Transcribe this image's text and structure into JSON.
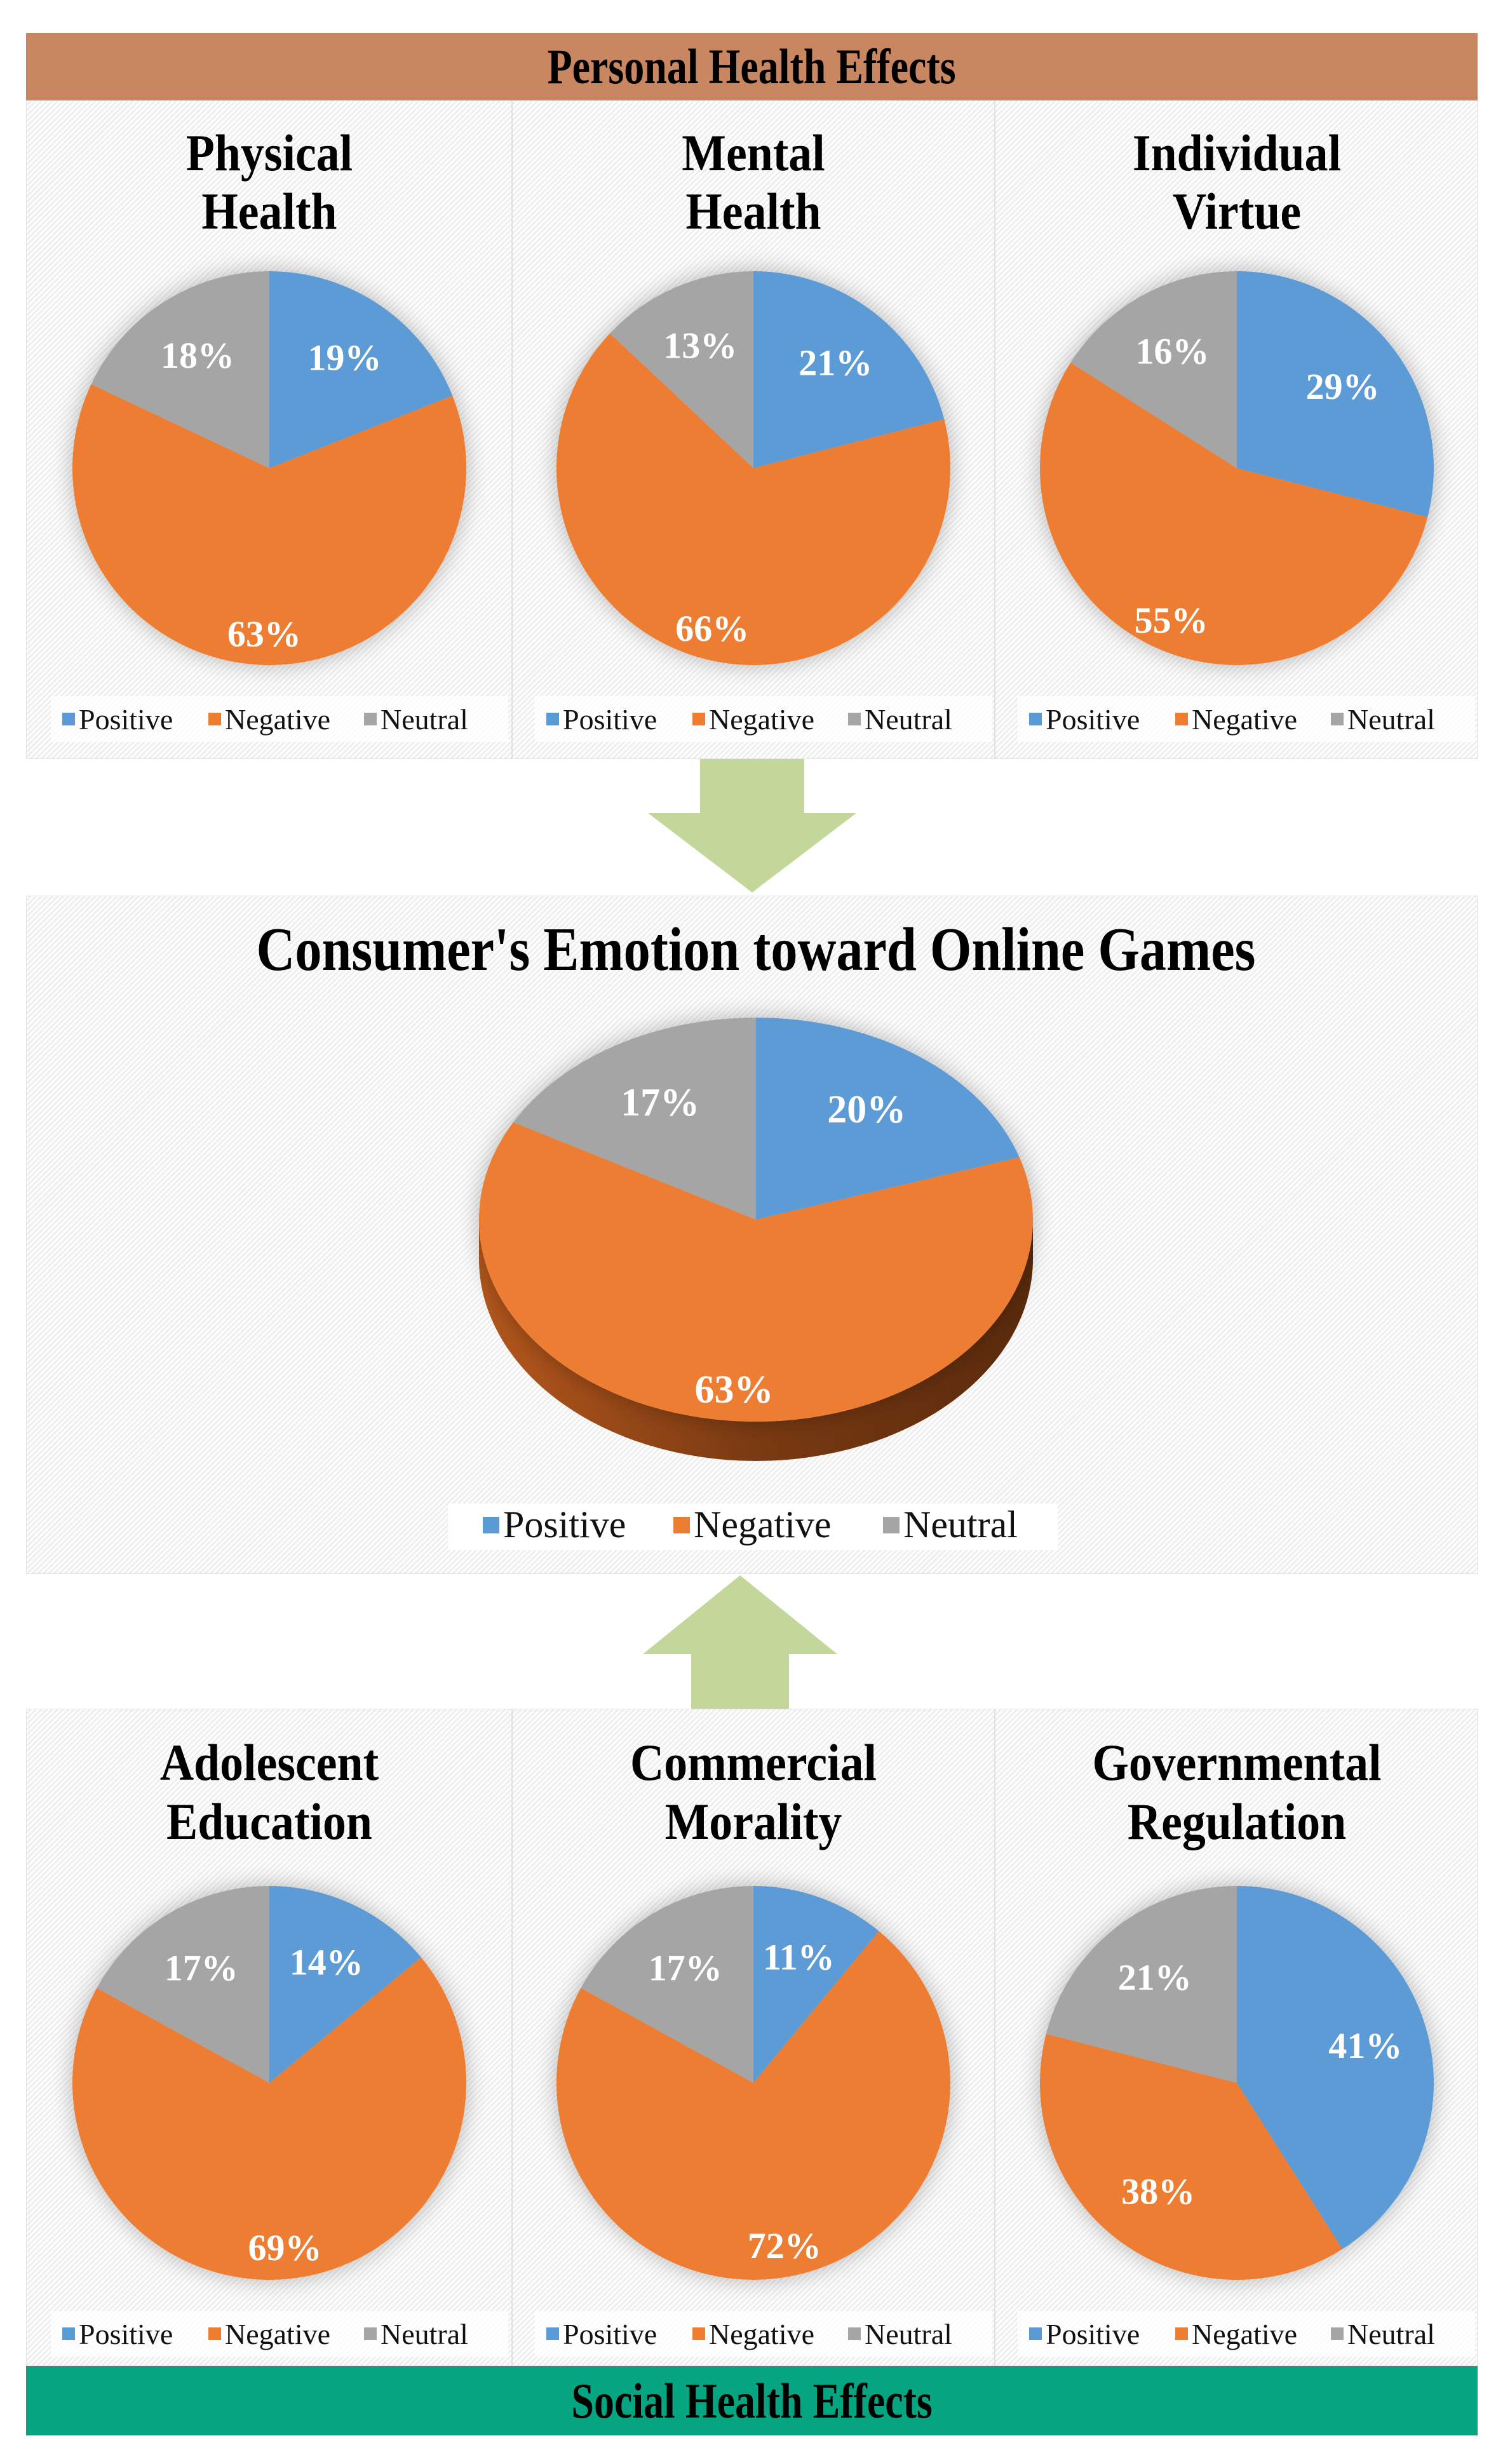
{
  "header": {
    "title": "Personal Health Effects",
    "color": "#C98761"
  },
  "footer": {
    "title": "Social Health Effects",
    "color": "#05A582"
  },
  "arrows": {
    "color": "#C4D79B",
    "top": "arrow-down",
    "bottom": "arrow-up"
  },
  "legend": {
    "items": [
      {
        "label": "Positive",
        "color": "#5B9BD5"
      },
      {
        "label": "Negative",
        "color": "#ED7D31"
      },
      {
        "label": "Neutral",
        "color": "#A5A5A5"
      }
    ]
  },
  "chart_data": [
    {
      "id": "physical-health",
      "type": "pie",
      "group": "Personal Health Effects",
      "title": [
        "Physical",
        "Health"
      ],
      "categories": [
        "Positive",
        "Negative",
        "Neutral"
      ],
      "values": [
        19,
        63,
        18
      ],
      "labels": [
        "19%",
        "63%",
        "18%"
      ],
      "legend": "bottom"
    },
    {
      "id": "mental-health",
      "type": "pie",
      "group": "Personal Health Effects",
      "title": [
        "Mental",
        "Health"
      ],
      "categories": [
        "Positive",
        "Negative",
        "Neutral"
      ],
      "values": [
        21,
        66,
        13
      ],
      "labels": [
        "21%",
        "66%",
        "13%"
      ],
      "legend": "bottom"
    },
    {
      "id": "individual-virtue",
      "type": "pie",
      "group": "Personal Health Effects",
      "title": [
        "Individual",
        "Virtue"
      ],
      "categories": [
        "Positive",
        "Negative",
        "Neutral"
      ],
      "values": [
        29,
        55,
        16
      ],
      "labels": [
        "29%",
        "55%",
        "16%"
      ],
      "legend": "bottom"
    },
    {
      "id": "consumer-emotion",
      "type": "pie",
      "group": "Overall",
      "style": "3d",
      "title": [
        "Consumer's Emotion toward Online Games"
      ],
      "categories": [
        "Positive",
        "Negative",
        "Neutral"
      ],
      "values": [
        20,
        63,
        17
      ],
      "labels": [
        "20%",
        "63%",
        "17%"
      ],
      "legend": "bottom"
    },
    {
      "id": "adolescent-education",
      "type": "pie",
      "group": "Social Health Effects",
      "title": [
        "Adolescent",
        "Education"
      ],
      "categories": [
        "Positive",
        "Negative",
        "Neutral"
      ],
      "values": [
        14,
        69,
        17
      ],
      "labels": [
        "14%",
        "69%",
        "17%"
      ],
      "legend": "bottom"
    },
    {
      "id": "commercial-morality",
      "type": "pie",
      "group": "Social Health Effects",
      "title": [
        "Commercial",
        "Morality"
      ],
      "categories": [
        "Positive",
        "Negative",
        "Neutral"
      ],
      "values": [
        11,
        72,
        17
      ],
      "labels": [
        "11%",
        "72%",
        "17%"
      ],
      "legend": "bottom"
    },
    {
      "id": "governmental-regulation",
      "type": "pie",
      "group": "Social Health Effects",
      "title": [
        "Governmental",
        "Regulation"
      ],
      "categories": [
        "Positive",
        "Negative",
        "Neutral"
      ],
      "values": [
        41,
        38,
        21
      ],
      "labels": [
        "41%",
        "38%",
        "21%"
      ],
      "legend": "bottom"
    }
  ]
}
